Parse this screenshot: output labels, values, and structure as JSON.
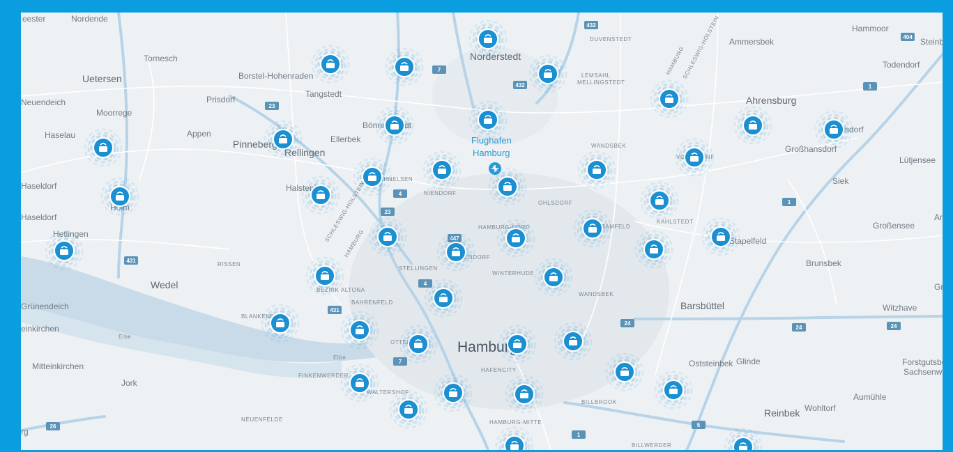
{
  "colors": {
    "frame": "#0a9ee0",
    "land": "#eef1f4",
    "water": "#c9dbe8",
    "motorway": "#b7d3e7",
    "road": "#ffffff",
    "marker": "#1a8fd1",
    "shield": "#5b93b8"
  },
  "map": {
    "labels": {
      "nordende": "Nordende",
      "eester": "eester",
      "tornesch": "Tornesch",
      "uetersen": "Uetersen",
      "neuendeich": "Neuendeich",
      "moorrege": "Moorrege",
      "haselau": "Haselau",
      "appen": "Appen",
      "pinneberg": "Pinneberg",
      "rellingen": "Rellingen",
      "ellerbek": "Ellerbek",
      "halstenbek": "Halstenbek",
      "prisdorf": "Prisdorf",
      "borstel_hohenraden": "Borstel-Hohenraden",
      "tangstedt": "Tangstedt",
      "boenningstedt": "Bönningstedt",
      "norderstedt": "Norderstedt",
      "duvenstedt": "DUVENSTEDT",
      "lemsahl": "LEMSAHL",
      "mellingstedt": "MELLINGSTEDT",
      "ammersbek": "Ammersbek",
      "hammoor": "Hammoor",
      "steinburg": "Steinb",
      "todendorf": "Todendorf",
      "ahrensburg": "Ahrensburg",
      "siek": "Siek",
      "grosshansdorf": "Großhansdorf",
      "hoisdorf": "Hoisdorf",
      "luetjensee": "Lütjensee",
      "grossensee": "Großensee",
      "ar": "Ar",
      "stapelfeld": "Stapelfeld",
      "braak": "Brunsbek",
      "gra": "Gra",
      "barsbuettel": "Barsbüttel",
      "witzhave": "Witzhave",
      "glinde": "Glinde",
      "oststeinbek": "Oststeinbek",
      "forstgutsbezirk": "Forstgutsbe",
      "sachsenwald": "Sachsenw",
      "aumuehle": "Aumühle",
      "wohltorf": "Wohltorf",
      "reinbek": "Reinbek",
      "haseldorf1": "Haseldorf",
      "haseldorf2": "Haseldorf",
      "holm": "Holm",
      "hetlingen": "Hetlingen",
      "wedel": "Wedel",
      "gruenendeich": "Grünendeich",
      "steinkirchen": "einkirchen",
      "mitteinkirchen": "Mitteinkirchen",
      "jork": "Jork",
      "neuenfelde": "NEUENFELDE",
      "rissen": "RISSEN",
      "blankenese": "BLANKENESE",
      "bezirk_altona": "BEZIRK ALTONA",
      "bahrenfeld": "BAHRENFELD",
      "stellingen": "STELLINGEN",
      "schnelsen": "SCHNELSEN",
      "niendorf": "NIENDORF",
      "eppendorf": "EPPENDORF",
      "hamburg_nord": "HAMBURG-NORD",
      "winterhude": "WINTERHUDE",
      "wandsbek1": "WANDSBEK",
      "wandsbek2": "WANDSBEK",
      "ohlsdorf": "OHLSDORF",
      "bramfeld": "BRAMFELD",
      "kahlstedt": "KAHLSTEDT",
      "volksdorf": "VOLKSDORF",
      "hamburg": "Hamburg",
      "hafencity": "HAFENCITY",
      "hamburg_mitte": "HAMBURG-MITTE",
      "billbrook": "BILLBROOK",
      "billwerder": "BILLWERDER",
      "finkenwerder": "FINKENWERDER",
      "waltershof": "WALTERSHOF",
      "ottensen": "OTTENSEN",
      "elbe1": "Elbe",
      "elbe2": "Elbe",
      "sh1": "SCHLESWIG-HOLSTEIN",
      "sh2": "HAMBURG",
      "sh3": "HAMBURG",
      "sh4": "SCHLESWIG-HOLSTEIN",
      "flughafen1": "Flughafen",
      "flughafen2": "Hamburg",
      "jenfeld": "HORN",
      "rg": "rg"
    },
    "roads": [
      "432",
      "432",
      "7",
      "23",
      "4",
      "23",
      "7",
      "431",
      "431",
      "4",
      "24",
      "24",
      "24",
      "1",
      "1",
      "1",
      "5",
      "26",
      "447",
      "404"
    ]
  }
}
